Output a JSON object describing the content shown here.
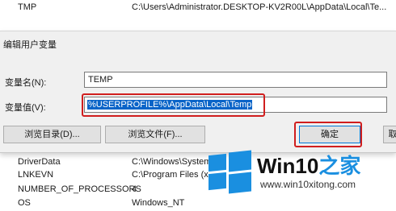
{
  "background_list": {
    "top_row": {
      "name": "TMP",
      "value": "C:\\Users\\Administrator.DESKTOP-KV2R00L\\AppData\\Local\\Te..."
    },
    "rows": [
      {
        "name": "DriverData",
        "value": "C:\\Windows\\System"
      },
      {
        "name": "LNKEVN",
        "value": "C:\\Program Files (x"
      },
      {
        "name": "NUMBER_OF_PROCESSORS",
        "value": "4"
      },
      {
        "name": "OS",
        "value": "Windows_NT"
      }
    ]
  },
  "dialog": {
    "title": "编辑用户变量",
    "name_label": "变量名(N):",
    "name_value": "TEMP",
    "value_label": "变量值(V):",
    "value_value": "%USERPROFILE%\\AppData\\Local\\Temp",
    "browse_dir_label": "浏览目录(D)...",
    "browse_file_label": "浏览文件(F)...",
    "ok_label": "确定",
    "cancel_label": "取"
  },
  "watermark": {
    "brand_prefix": "Win10",
    "brand_suffix": "之家",
    "url": "www.win10xitong.com",
    "logo_icon": "windows-logo-icon"
  },
  "colors": {
    "highlight": "#d01e1e",
    "selection": "#0a64c8",
    "brand_blue": "#1a8fe0"
  }
}
